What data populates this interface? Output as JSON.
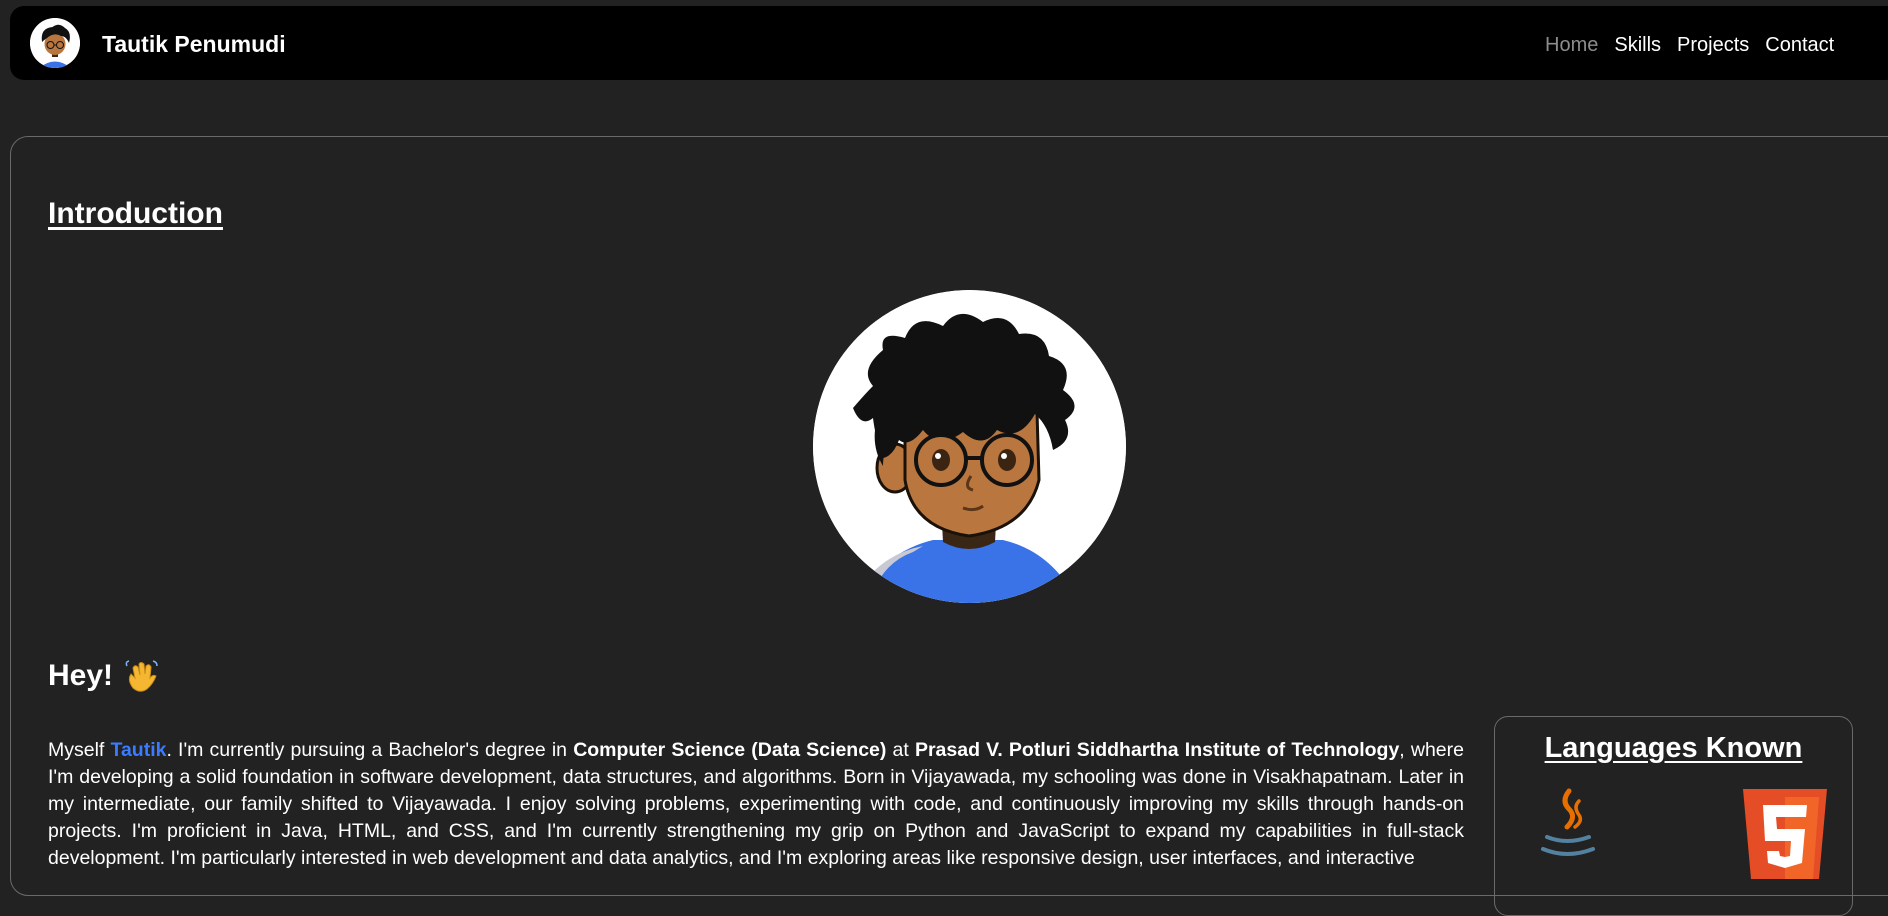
{
  "navbar": {
    "brand_name": "Tautik Penumudi",
    "links": [
      {
        "label": "Home",
        "active": true
      },
      {
        "label": "Skills",
        "active": false
      },
      {
        "label": "Projects",
        "active": false
      },
      {
        "label": "Contact",
        "active": false
      }
    ]
  },
  "intro": {
    "heading": "Introduction",
    "greeting": "Hey!",
    "bio": {
      "p1": "Myself ",
      "name": "Tautik",
      "p2": ". I'm currently pursuing a Bachelor's degree in ",
      "degree": "Computer Science (Data Science)",
      "p3": " at ",
      "college": "Prasad V. Potluri Siddhartha Institute of Technology",
      "p4": ", where I'm developing a solid foundation in software development, data structures, and algorithms. Born in Vijayawada, my schooling was done in Visakhapatnam. Later in my intermediate, our family shifted to Vijayawada. I enjoy solving problems, experimenting with code, and continuously improving my skills through hands-on projects. I'm proficient in Java, HTML, and CSS, and I'm currently strengthening my grip on Python and JavaScript to expand my capabilities in full-stack development. I'm particularly interested in web development and data analytics, and I'm exploring areas like responsive design, user interfaces, and interactive"
    }
  },
  "languages": {
    "heading": "Languages Known",
    "icons": [
      "java-icon",
      "html5-icon"
    ]
  },
  "colors": {
    "background": "#222222",
    "navbar": "#000000",
    "accent_blue": "#3a7bff",
    "html5_orange": "#e44d26",
    "muted_link": "#8c8c8c"
  }
}
